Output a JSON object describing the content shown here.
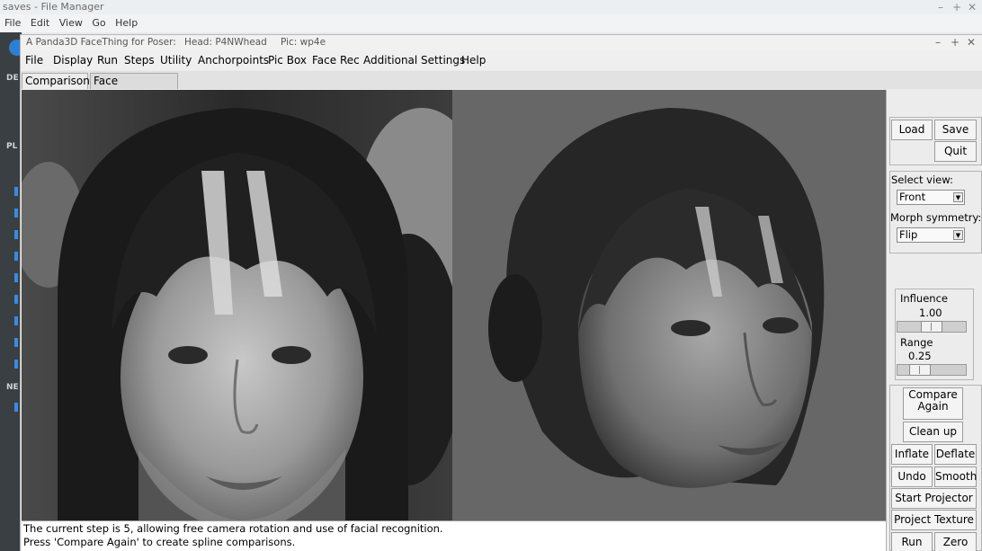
{
  "file_manager": {
    "title": "saves - File Manager",
    "menu": [
      "File",
      "Edit",
      "View",
      "Go",
      "Help"
    ],
    "sidebar_sections": [
      "DE",
      "PL",
      "NE"
    ]
  },
  "window": {
    "title": "A Panda3D FaceThing for Poser:",
    "head": "Head: P4NWhead",
    "pic": "Pic: wp4e",
    "minimize": "–",
    "maximize": "+",
    "close": "✕"
  },
  "menubar": [
    "File",
    "Display",
    "Run",
    "Steps",
    "Utility",
    "Anchorpoints",
    "Pic Box",
    "Face Rec",
    "Additional Settings",
    "Help"
  ],
  "tabs": [
    {
      "label": "Comparisons",
      "active": false
    },
    {
      "label": "Face Recognition",
      "active": true
    }
  ],
  "panel": {
    "load": "Load",
    "save": "Save",
    "quit": "Quit",
    "select_view_label": "Select view:",
    "select_view_value": "Front",
    "morph_symmetry_label": "Morph symmetry:",
    "morph_symmetry_value": "Flip",
    "influence_label": "Influence",
    "influence_value": "1.00",
    "influence_level": 0.5,
    "range_label": "Range",
    "range_value": "0.25",
    "range_level": 0.25,
    "compare_again_line1": "Compare",
    "compare_again_line2": "Again",
    "clean_up": "Clean up",
    "inflate": "Inflate",
    "deflate": "Deflate",
    "undo": "Undo",
    "smooth": "Smooth",
    "start_projector": "Start Projector",
    "project_texture": "Project Texture",
    "run": "Run",
    "zero": "Zero"
  },
  "status": {
    "line1": "The current step is 5, allowing free camera rotation and use of facial recognition.",
    "line2": "Press 'Compare Again' to create spline comparisons."
  },
  "colors": {
    "render_bg": "#676767",
    "sidebar_bg": "#3a3f44",
    "accent": "#2e7fd1"
  }
}
